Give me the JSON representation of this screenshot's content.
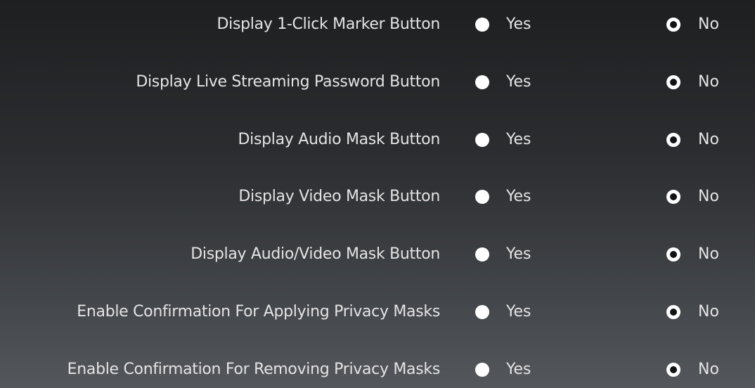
{
  "settings": [
    {
      "label": "Display 1-Click Marker Button",
      "yes_label": "Yes",
      "no_label": "No",
      "selected": "No"
    },
    {
      "label": "Display Live Streaming Password Button",
      "yes_label": "Yes",
      "no_label": "No",
      "selected": "No"
    },
    {
      "label": "Display Audio Mask Button",
      "yes_label": "Yes",
      "no_label": "No",
      "selected": "No"
    },
    {
      "label": "Display Video Mask Button",
      "yes_label": "Yes",
      "no_label": "No",
      "selected": "No"
    },
    {
      "label": "Display Audio/Video Mask Button",
      "yes_label": "Yes",
      "no_label": "No",
      "selected": "No"
    },
    {
      "label": "Enable Confirmation For Applying Privacy Masks",
      "yes_label": "Yes",
      "no_label": "No",
      "selected": "No"
    },
    {
      "label": "Enable Confirmation For Removing Privacy Masks",
      "yes_label": "Yes",
      "no_label": "No",
      "selected": "No"
    }
  ]
}
